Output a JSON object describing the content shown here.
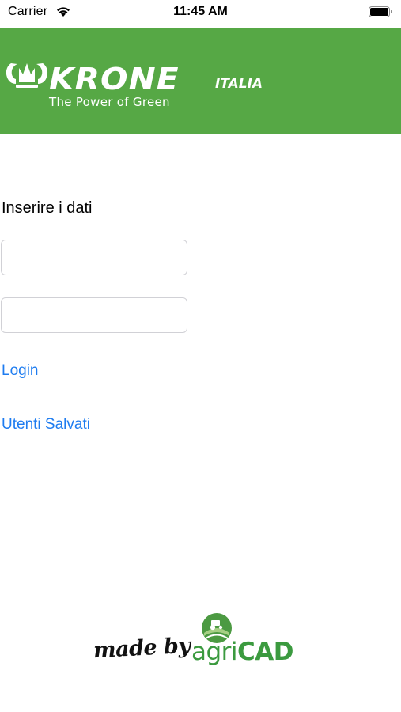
{
  "status_bar": {
    "carrier": "Carrier",
    "time": "11:45 AM"
  },
  "header": {
    "brand": "KRONE",
    "tagline": "The Power of Green",
    "country": "ITALIA",
    "background_color": "#56a845"
  },
  "form": {
    "prompt": "Inserire i dati",
    "username_value": "",
    "password_value": "",
    "login_label": "Login",
    "saved_users_label": "Utenti Salvati",
    "link_color": "#1e7cf0"
  },
  "footer": {
    "made_by": "made by",
    "brand_prefix": "agri",
    "brand_suffix": "CAD",
    "brand_color": "#3b9a3f"
  }
}
